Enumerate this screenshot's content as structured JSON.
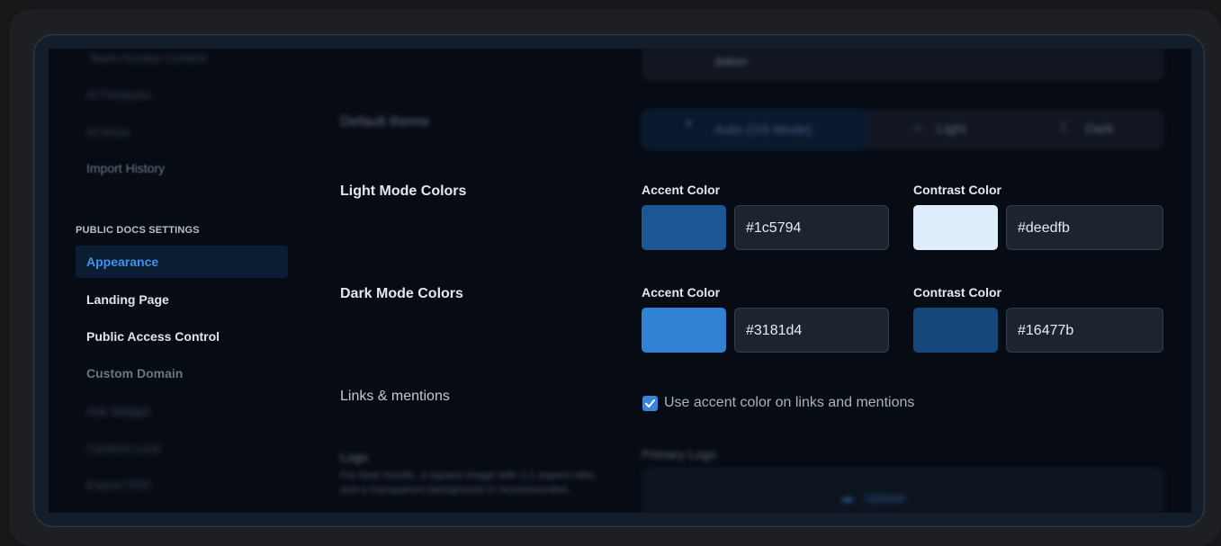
{
  "sidebar": {
    "blurred_items_top": [
      "Team Access Control",
      "AI Features",
      "AI Keys",
      "Import History"
    ],
    "section_heading": "PUBLIC DOCS SETTINGS",
    "items": [
      {
        "label": "Appearance",
        "active": true
      },
      {
        "label": "Landing Page"
      },
      {
        "label": "Public Access Control"
      },
      {
        "label": "Custom Domain",
        "dim": true
      }
    ],
    "blurred_items_bottom": [
      "Ask Widget",
      "Content Lock",
      "Export PDF"
    ]
  },
  "top_field": {
    "value": "Jotion"
  },
  "default_theme": {
    "label": "Default theme",
    "options": [
      "Auto (OS Mode)",
      "Light",
      "Dark"
    ],
    "selected": "Auto (OS Mode)"
  },
  "light_mode": {
    "label": "Light Mode Colors",
    "accent_label": "Accent Color",
    "accent_value": "#1c5794",
    "contrast_label": "Contrast Color",
    "contrast_value": "#deedfb"
  },
  "dark_mode": {
    "label": "Dark Mode Colors",
    "accent_label": "Accent Color",
    "accent_value": "#3181d4",
    "contrast_label": "Contrast Color",
    "contrast_value": "#16477b"
  },
  "links": {
    "label": "Links & mentions",
    "checkbox_label": "Use accent color on links and mentions",
    "checked": true
  },
  "logo": {
    "label": "Logo",
    "description": "For best results, a square image with 1:1 aspect ratio, and a transparent background is recommended.",
    "upload_label": "Primary Logo",
    "upload_button": "Upload"
  },
  "colors": {
    "light_accent": "#1c5794",
    "light_contrast": "#deedfb",
    "dark_accent": "#3181d4",
    "dark_contrast": "#16477b"
  }
}
